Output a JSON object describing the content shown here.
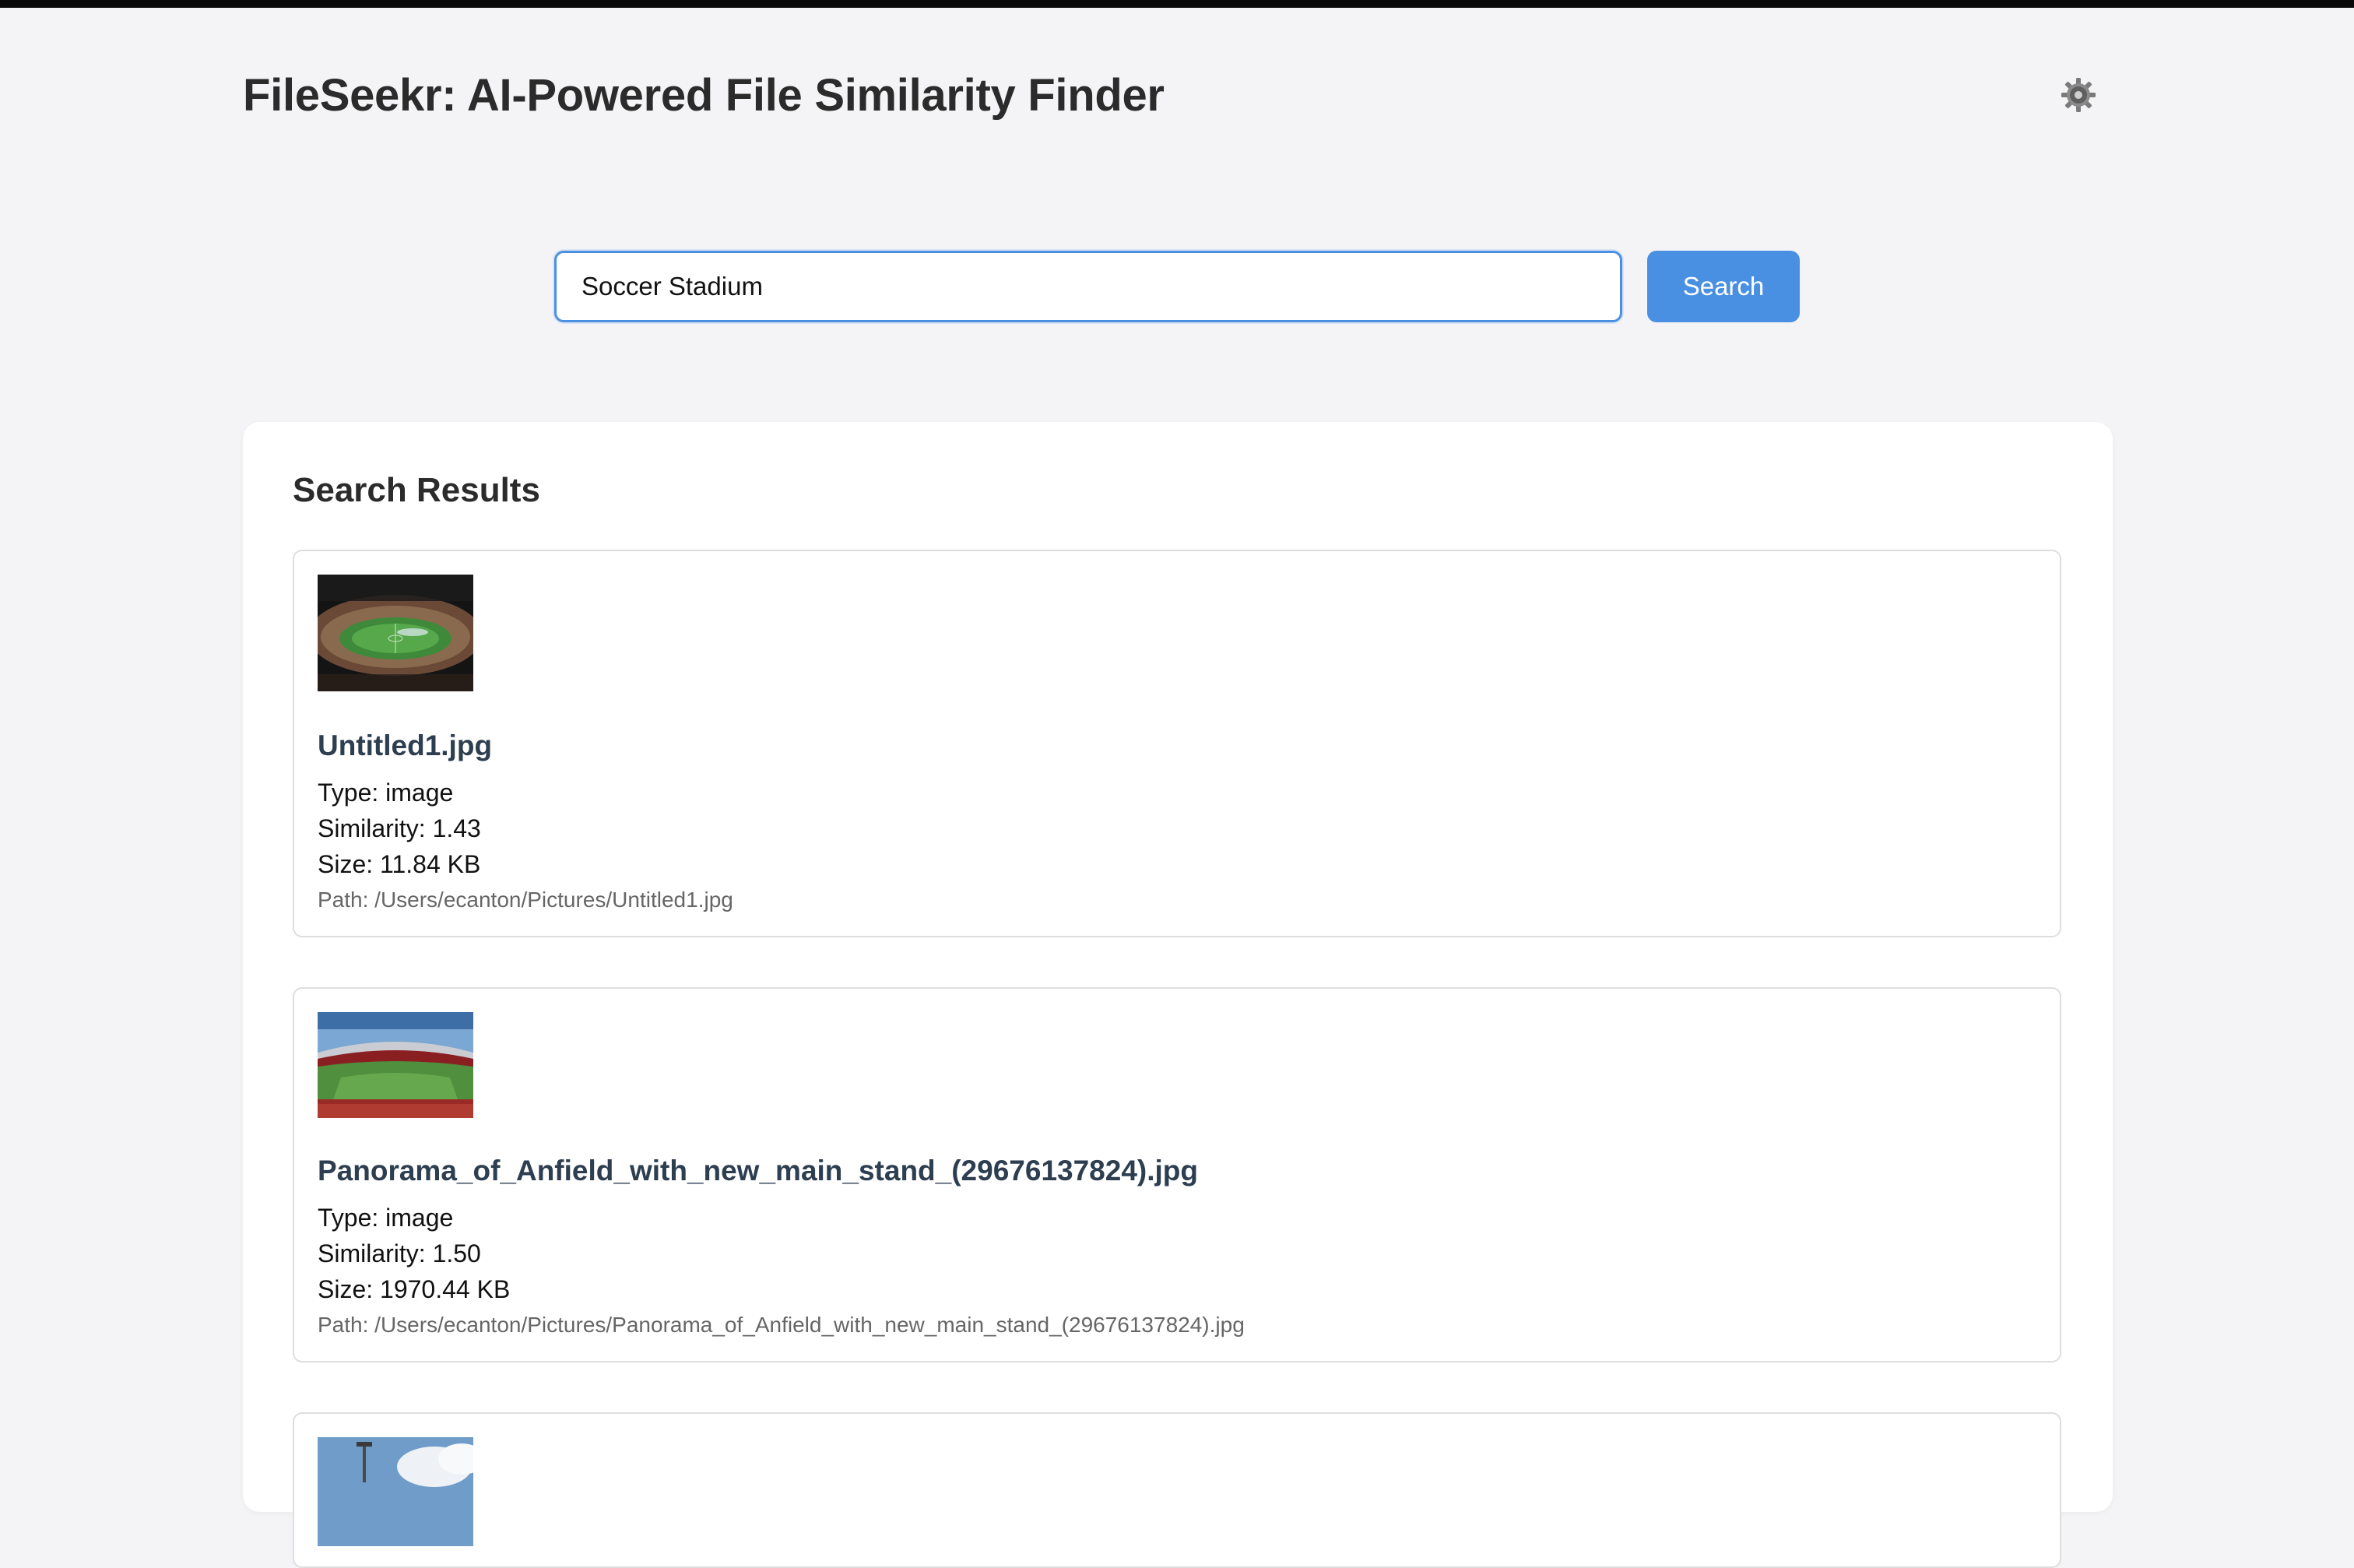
{
  "app": {
    "title": "FileSeekr: AI-Powered File Similarity Finder"
  },
  "search": {
    "value": "Soccer Stadium",
    "button_label": "Search"
  },
  "results": {
    "heading": "Search Results",
    "items": [
      {
        "name": "Untitled1.jpg",
        "type": "Type: image",
        "similarity": "Similarity: 1.43",
        "size": "Size: 11.84 KB",
        "path": "Path: /Users/ecanton/Pictures/Untitled1.jpg"
      },
      {
        "name": "Panorama_of_Anfield_with_new_main_stand_(29676137824).jpg",
        "type": "Type: image",
        "similarity": "Similarity: 1.50",
        "size": "Size: 1970.44 KB",
        "path": "Path: /Users/ecanton/Pictures/Panorama_of_Anfield_with_new_main_stand_(29676137824).jpg"
      }
    ]
  },
  "colors": {
    "accent": "#4a90e2",
    "background": "#f4f4f6",
    "file_name": "#2c3e50"
  },
  "icons": {
    "settings": "gear-icon"
  }
}
